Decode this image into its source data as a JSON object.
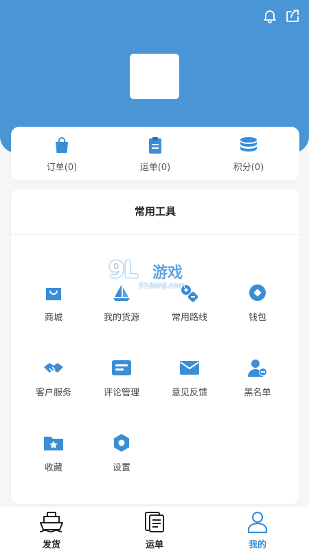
{
  "stats": [
    {
      "label": "订单(0)",
      "icon": "shopping-bag-icon"
    },
    {
      "label": "运单(0)",
      "icon": "clipboard-icon"
    },
    {
      "label": "积分(0)",
      "icon": "coin-stack-icon"
    }
  ],
  "tools": {
    "title": "常用工具",
    "items": [
      {
        "label": "商城",
        "icon": "shopping-bag-icon"
      },
      {
        "label": "我的货源",
        "icon": "sailboat-icon"
      },
      {
        "label": "常用路线",
        "icon": "route-icon"
      },
      {
        "label": "钱包",
        "icon": "wallet-icon"
      },
      {
        "label": "客户服务",
        "icon": "handshake-icon"
      },
      {
        "label": "评论管理",
        "icon": "comment-icon"
      },
      {
        "label": "意见反馈",
        "icon": "mail-icon"
      },
      {
        "label": "黑名单",
        "icon": "user-block-icon"
      },
      {
        "label": "收藏",
        "icon": "star-folder-icon"
      },
      {
        "label": "设置",
        "icon": "gear-icon"
      }
    ]
  },
  "watermark": {
    "brand": "9L",
    "name": "游戏",
    "url": "91danji.com"
  },
  "tabbar": [
    {
      "label": "发货",
      "icon": "ship-icon",
      "active": false
    },
    {
      "label": "运单",
      "icon": "document-list-icon",
      "active": false
    },
    {
      "label": "我的",
      "icon": "user-icon",
      "active": true
    }
  ],
  "colors": {
    "primary": "#4a95d5",
    "accent": "#3a8ed6",
    "background": "#f5f6f8"
  }
}
